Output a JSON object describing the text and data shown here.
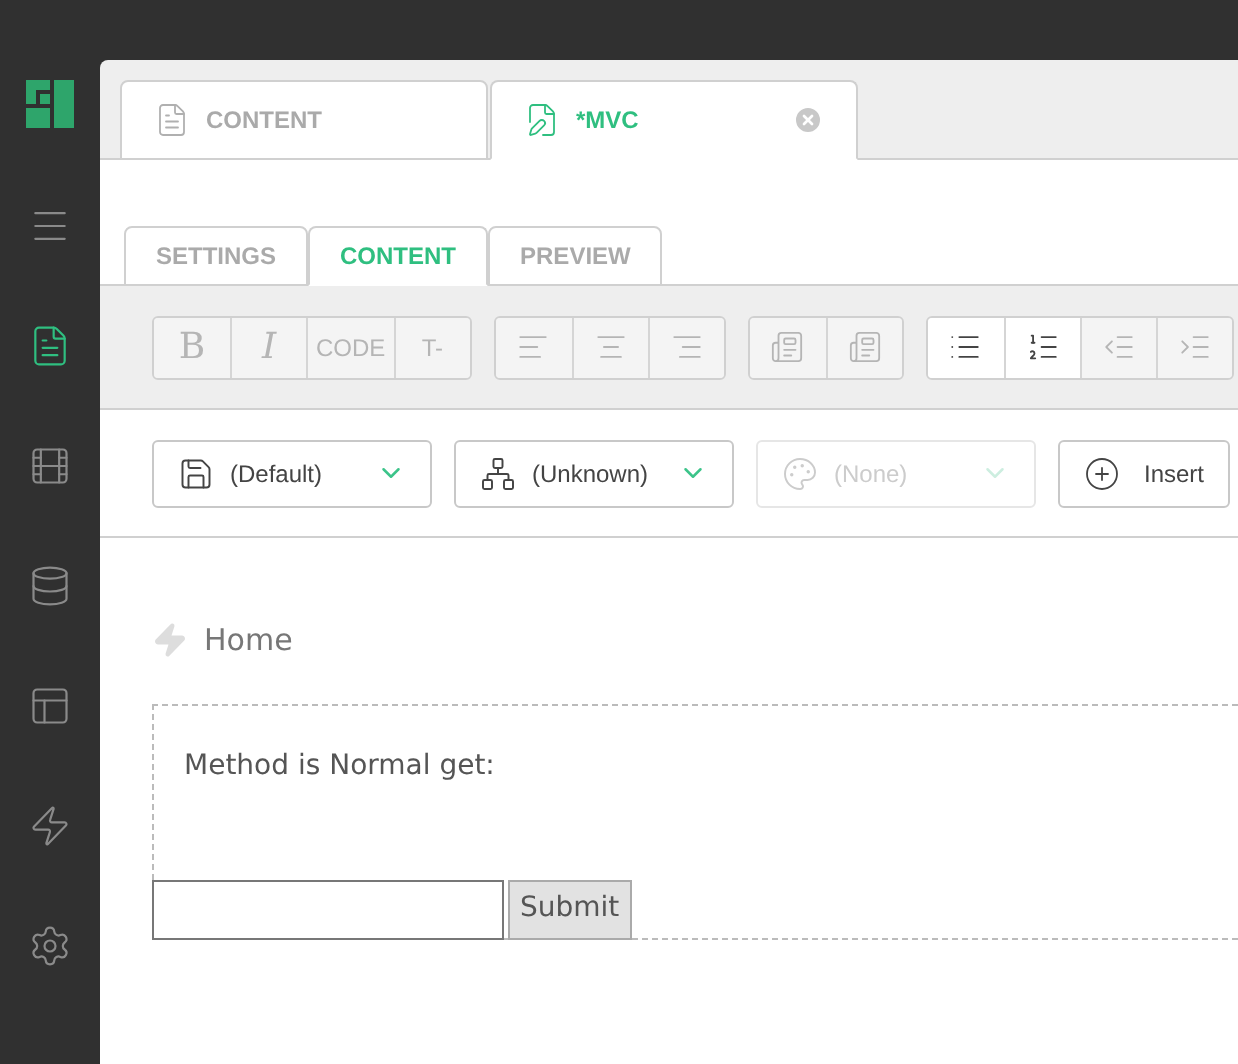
{
  "sidebar": {
    "items": [
      {
        "kind": "menu",
        "selected": false
      },
      {
        "kind": "document",
        "selected": true
      },
      {
        "kind": "film",
        "selected": false
      },
      {
        "kind": "database",
        "selected": false
      },
      {
        "kind": "layout",
        "selected": false
      },
      {
        "kind": "lightning",
        "selected": false
      },
      {
        "kind": "settings",
        "selected": false
      }
    ]
  },
  "document_tabs": [
    {
      "label": "CONTENT",
      "kind": "document",
      "selected": false,
      "closable": false
    },
    {
      "label": "*MVC",
      "kind": "edit",
      "selected": true,
      "closable": true
    }
  ],
  "view_tabs": [
    {
      "label": "SETTINGS",
      "selected": false
    },
    {
      "label": "CONTENT",
      "selected": true
    },
    {
      "label": "PREVIEW",
      "selected": false
    }
  ],
  "toolbar": [
    [
      {
        "kind": "bold",
        "label": "B",
        "disabled": true
      },
      {
        "kind": "italic",
        "label": "I",
        "disabled": true
      },
      {
        "kind": "text",
        "label": "CODE",
        "disabled": true
      },
      {
        "kind": "text",
        "label": "T-",
        "disabled": true
      }
    ],
    [
      {
        "kind": "align-left",
        "disabled": true
      },
      {
        "kind": "align-center",
        "disabled": true
      },
      {
        "kind": "align-right",
        "disabled": true
      }
    ],
    [
      {
        "kind": "image-left",
        "disabled": true
      },
      {
        "kind": "image-right",
        "disabled": true
      }
    ],
    [
      {
        "kind": "bullet-list",
        "disabled": false
      },
      {
        "kind": "numbered-list",
        "disabled": false
      },
      {
        "kind": "outdent",
        "disabled": true
      },
      {
        "kind": "indent",
        "disabled": true
      }
    ]
  ],
  "selectors": [
    {
      "kind": "template",
      "value": "(Default)",
      "disabled": false
    },
    {
      "kind": "hierarchy",
      "value": "(Unknown)",
      "disabled": false
    },
    {
      "kind": "palette",
      "value": "(None)",
      "disabled": true
    }
  ],
  "insert_button": {
    "label": "Insert"
  },
  "breadcrumb": {
    "label": "Home"
  },
  "content": {
    "text": "Method is Normal get:",
    "submit": "Submit"
  }
}
